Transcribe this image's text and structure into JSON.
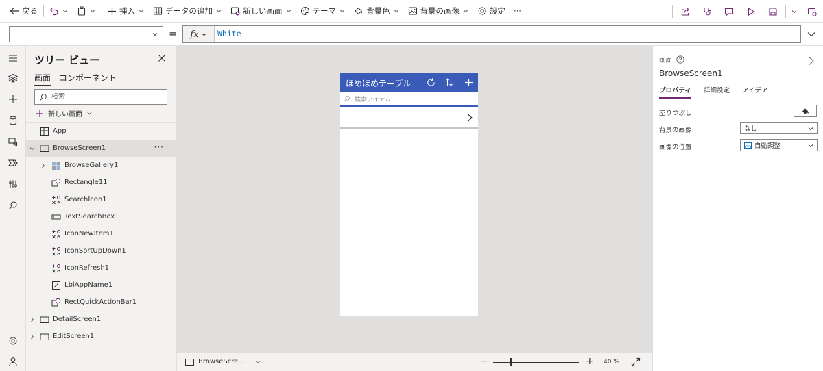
{
  "toolbar": {
    "back_label": "戻る",
    "insert_label": "挿入",
    "add_data_label": "データの追加",
    "new_screen_label": "新しい画面",
    "theme_label": "テーマ",
    "bg_color_label": "背景色",
    "bg_image_label": "背景の画像",
    "settings_label": "設定",
    "more_label": "···"
  },
  "formula_bar": {
    "property_value": "",
    "equals": "=",
    "fx_label": "fx",
    "formula": "White"
  },
  "tree_view": {
    "title": "ツリー ビュー",
    "tabs": [
      {
        "label": "画面",
        "active": true
      },
      {
        "label": "コンポーネント",
        "active": false
      }
    ],
    "search_placeholder": "検索",
    "new_screen_label": "新しい画面",
    "nodes": [
      {
        "label": "App",
        "icon": "app-icon",
        "level": 0,
        "expander": "none"
      },
      {
        "label": "BrowseScreen1",
        "icon": "screen-icon",
        "level": 0,
        "expander": "expanded",
        "selected": true,
        "more": "···"
      },
      {
        "label": "BrowseGallery1",
        "icon": "gallery-icon",
        "level": 1,
        "expander": "collapsed"
      },
      {
        "label": "Rectangle11",
        "icon": "shape-icon",
        "level": 1,
        "expander": "none"
      },
      {
        "label": "SearchIcon1",
        "icon": "icon-control-icon",
        "level": 1,
        "expander": "none"
      },
      {
        "label": "TextSearchBox1",
        "icon": "textinput-icon",
        "level": 1,
        "expander": "none"
      },
      {
        "label": "IconNewItem1",
        "icon": "icon-control-icon",
        "level": 1,
        "expander": "none"
      },
      {
        "label": "IconSortUpDown1",
        "icon": "icon-control-icon",
        "level": 1,
        "expander": "none"
      },
      {
        "label": "IconRefresh1",
        "icon": "icon-control-icon",
        "level": 1,
        "expander": "none"
      },
      {
        "label": "LblAppName1",
        "icon": "label-icon",
        "level": 1,
        "expander": "none"
      },
      {
        "label": "RectQuickActionBar1",
        "icon": "shape-icon",
        "level": 1,
        "expander": "none"
      },
      {
        "label": "DetailScreen1",
        "icon": "screen-icon",
        "level": 0,
        "expander": "collapsed"
      },
      {
        "label": "EditScreen1",
        "icon": "screen-icon",
        "level": 0,
        "expander": "collapsed"
      }
    ]
  },
  "canvas": {
    "app_title": "ほめほめテーブル",
    "search_placeholder": "検索アイテム",
    "header_color": "#3a5bb8"
  },
  "status_bar": {
    "screen_label": "BrowseScre...",
    "zoom_minus": "−",
    "zoom_plus": "+",
    "zoom_value": "40 %",
    "zoom_percent": 40
  },
  "properties": {
    "type_label": "画面",
    "screen_name": "BrowseScreen1",
    "tabs": [
      {
        "label": "プロパティ",
        "active": true
      },
      {
        "label": "詳細設定",
        "active": false
      },
      {
        "label": "アイデア",
        "active": false
      }
    ],
    "fill_label": "塗りつぶし",
    "bg_image_label": "背景の画像",
    "bg_image_value": "なし",
    "image_position_label": "画像の位置",
    "image_position_value": "自動調整"
  },
  "colors": {
    "accent": "#742774",
    "canvas_bg": "#e1dfdd"
  }
}
